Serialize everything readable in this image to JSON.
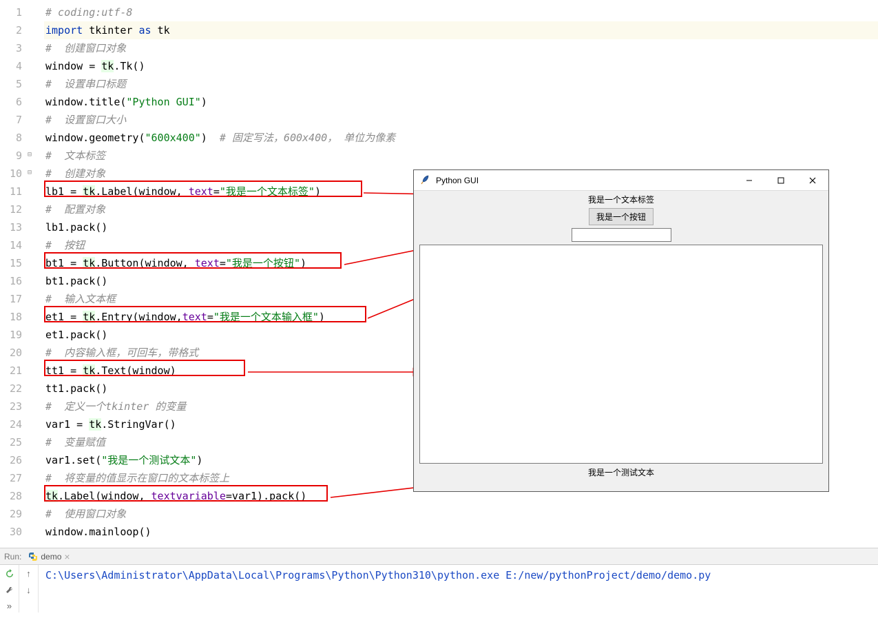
{
  "lineNumbers": [
    "1",
    "2",
    "3",
    "4",
    "5",
    "6",
    "7",
    "8",
    "9",
    "10",
    "11",
    "12",
    "13",
    "14",
    "15",
    "16",
    "17",
    "18",
    "19",
    "20",
    "21",
    "22",
    "23",
    "24",
    "25",
    "26",
    "27",
    "28",
    "29",
    "30"
  ],
  "code": {
    "l1_comment": "# coding:utf-8",
    "l2_import": "import",
    "l2_tkinter": " tkinter ",
    "l2_as": "as",
    "l2_tk": " tk",
    "l3": "#  创建窗口对象",
    "l4_a": "window = ",
    "l4_b": "tk",
    "l4_c": ".Tk()",
    "l5": "#  设置串口标题",
    "l6_a": "window.title(",
    "l6_b": "\"Python GUI\"",
    "l6_c": ")",
    "l7": "#  设置窗口大小",
    "l8_a": "window.geometry(",
    "l8_b": "\"600x400\"",
    "l8_c": ")  ",
    "l8_d": "# 固定写法，600x400， 单位为像素",
    "l9": "#  文本标签",
    "l10": "#  创建对象",
    "l11_a": "lb1 = ",
    "l11_b": "tk",
    "l11_c": ".Label(window, ",
    "l11_p": "text",
    "l11_d": "=",
    "l11_s": "\"我是一个文本标签\"",
    "l11_e": ")",
    "l12": "#  配置对象",
    "l13": "lb1.pack()",
    "l14": "#  按钮",
    "l15_a": "bt1 = ",
    "l15_b": "tk",
    "l15_c": ".Button(window, ",
    "l15_p": "text",
    "l15_d": "=",
    "l15_s": "\"我是一个按钮\"",
    "l15_e": ")",
    "l16": "bt1.pack()",
    "l17": "#  输入文本框",
    "l18_a": "et1 = ",
    "l18_b": "tk",
    "l18_c": ".Entry(window,",
    "l18_p": "text",
    "l18_d": "=",
    "l18_s": "\"我是一个文本输入框\"",
    "l18_e": ")",
    "l19": "et1.pack()",
    "l20": "#  内容输入框，可回车，带格式",
    "l21_a": "tt1 = ",
    "l21_b": "tk",
    "l21_c": ".Text(window)",
    "l22": "tt1.pack()",
    "l23": "#  定义一个tkinter 的变量",
    "l24_a": "var1 = ",
    "l24_b": "tk",
    "l24_c": ".StringVar()",
    "l25": "#  变量赋值",
    "l26_a": "var1.set(",
    "l26_s": "\"我是一个测试文本\"",
    "l26_c": ")",
    "l27": "#  将变量的值显示在窗口的文本标签上",
    "l28_a": "tk",
    "l28_b": ".Label(window, ",
    "l28_p": "textvariable",
    "l28_c": "=var1).pack()",
    "l29": "#  使用窗口对象",
    "l30": "window.mainloop()"
  },
  "tkwin": {
    "title": "Python GUI",
    "label1": "我是一个文本标签",
    "button": "我是一个按钮",
    "label2": "我是一个测试文本"
  },
  "run": {
    "label": "Run:",
    "tab": "demo",
    "output": "C:\\Users\\Administrator\\AppData\\Local\\Programs\\Python\\Python310\\python.exe E:/new/pythonProject/demo/demo.py"
  }
}
